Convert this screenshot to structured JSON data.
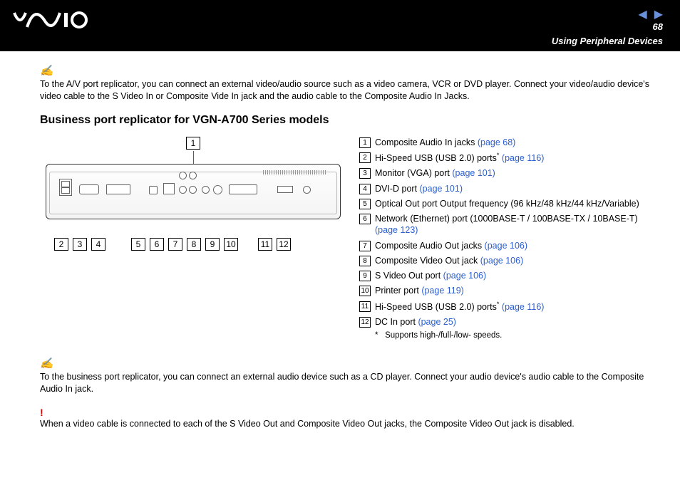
{
  "header": {
    "page_number": "68",
    "section": "Using Peripheral Devices"
  },
  "note1": {
    "icon": "✍",
    "text": "To the A/V port replicator, you can connect an external video/audio source such as a video camera, VCR or DVD player. Connect your video/audio device's video cable to the S Video In or Composite Vide In jack and the audio cable to the Composite Audio In Jacks."
  },
  "heading": "Business port replicator for VGN-A700 Series models",
  "diagram": {
    "top_callout": "1",
    "bottom_callouts": [
      "2",
      "3",
      "4",
      "5",
      "6",
      "7",
      "8",
      "9",
      "10",
      "11",
      "12"
    ]
  },
  "legend": [
    {
      "num": "1",
      "text": "Composite Audio In jacks ",
      "link": "(page 68)"
    },
    {
      "num": "2",
      "text": "Hi-Speed USB (USB 2.0) ports",
      "sup": "*",
      "post": " ",
      "link": "(page 116)"
    },
    {
      "num": "3",
      "text": "Monitor (VGA) port ",
      "link": "(page 101)"
    },
    {
      "num": "4",
      "text": "DVI-D port ",
      "link": "(page 101)"
    },
    {
      "num": "5",
      "text": "Optical Out port Output frequency (96 kHz/48 kHz/44 kHz/Variable)"
    },
    {
      "num": "6",
      "text": "Network (Ethernet) port (1000BASE-T / 100BASE-TX / 10BASE-T) ",
      "link": "(page 123)"
    },
    {
      "num": "7",
      "text": "Composite Audio Out jacks ",
      "link": "(page 106)"
    },
    {
      "num": "8",
      "text": "Composite Video Out jack ",
      "link": "(page 106)"
    },
    {
      "num": "9",
      "text": "S Video Out port ",
      "link": "(page 106)"
    },
    {
      "num": "10",
      "text": "Printer port ",
      "link": "(page 119)"
    },
    {
      "num": "11",
      "text": "Hi-Speed USB (USB 2.0) ports",
      "sup": "*",
      "post": " ",
      "link": "(page 116)"
    },
    {
      "num": "12",
      "text": "DC In port ",
      "link": "(page 25)"
    }
  ],
  "footnote": {
    "mark": "*",
    "text": "Supports high-/full-/low- speeds."
  },
  "note2": {
    "icon": "✍",
    "text": "To the business port replicator, you can connect an external audio device such as a CD player. Connect your audio device's audio cable to the Composite Audio In jack."
  },
  "warning": {
    "icon": "!",
    "text": "When a video cable is connected to each of the S Video Out and Composite Video Out jacks, the Composite Video Out jack is disabled."
  }
}
